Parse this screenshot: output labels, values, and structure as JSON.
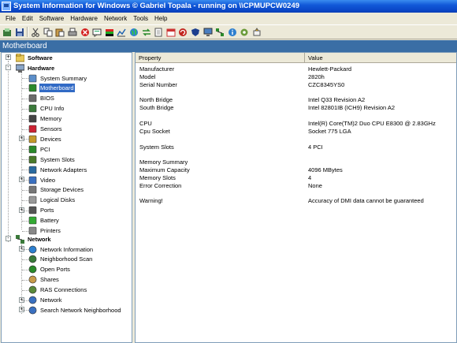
{
  "window": {
    "title": "System Information for Windows  © Gabriel Topala - running on \\\\CPMUPCW0249"
  },
  "menu": [
    "File",
    "Edit",
    "Software",
    "Hardware",
    "Network",
    "Tools",
    "Help"
  ],
  "toolbar": {
    "icons": [
      "open-report-icon",
      "save-icon",
      "cut-icon",
      "copy-icon",
      "paste-icon",
      "print-icon",
      "stop-icon",
      "message-icon",
      "color-bars-icon",
      "chart-icon",
      "globe-icon",
      "transfer-icon",
      "document-icon",
      "calendar-icon",
      "refresh-icon",
      "shield-icon",
      "display-icon",
      "network-icon",
      "info-icon",
      "settings-icon",
      "launch-icon"
    ]
  },
  "section": {
    "title": "Motherboard"
  },
  "tree": {
    "software": "Software",
    "hardware": "Hardware",
    "network": "Network",
    "hardware_items": [
      "System Summary",
      "Motherboard",
      "BIOS",
      "CPU Info",
      "Memory",
      "Sensors",
      "Devices",
      "PCI",
      "System Slots",
      "Network Adapters",
      "Video",
      "Storage Devices",
      "Logical Disks",
      "Ports",
      "Battery",
      "Printers"
    ],
    "network_items": [
      "Network Information",
      "Neighborhood Scan",
      "Open Ports",
      "Shares",
      "RAS Connections",
      "Network",
      "Search Network Neighborhood"
    ],
    "selected": "Motherboard"
  },
  "details": {
    "col_property": "Property",
    "col_value": "Value",
    "rows": [
      {
        "property": "Manufacturer",
        "value": "Hewlett-Packard"
      },
      {
        "property": "Model",
        "value": "2820h"
      },
      {
        "property": "Serial Number",
        "value": "CZC8345YS0"
      },
      {
        "property": "",
        "value": ""
      },
      {
        "property": "North Bridge",
        "value": "Intel Q33 Revision A2"
      },
      {
        "property": "South Bridge",
        "value": "Intel 82801IB (ICH9) Revision A2"
      },
      {
        "property": "",
        "value": ""
      },
      {
        "property": "CPU",
        "value": "Intel(R) Core(TM)2 Duo CPU E8300 @ 2.83GHz"
      },
      {
        "property": "Cpu Socket",
        "value": "Socket 775 LGA"
      },
      {
        "property": "",
        "value": ""
      },
      {
        "property": "System Slots",
        "value": "4 PCI"
      },
      {
        "property": "",
        "value": ""
      },
      {
        "property": "Memory Summary",
        "value": ""
      },
      {
        "property": "Maximum Capacity",
        "value": "4096 MBytes"
      },
      {
        "property": "Memory Slots",
        "value": "4"
      },
      {
        "property": "Error Correction",
        "value": "None"
      },
      {
        "property": "",
        "value": ""
      },
      {
        "property": "Warning!",
        "value": "Accuracy of DMI data cannot be guaranteed"
      }
    ]
  },
  "colors": {
    "titlebar": "#0a47c8",
    "section_bar": "#3a6ea5",
    "selection": "#316ac5",
    "chrome": "#ece9d8"
  }
}
